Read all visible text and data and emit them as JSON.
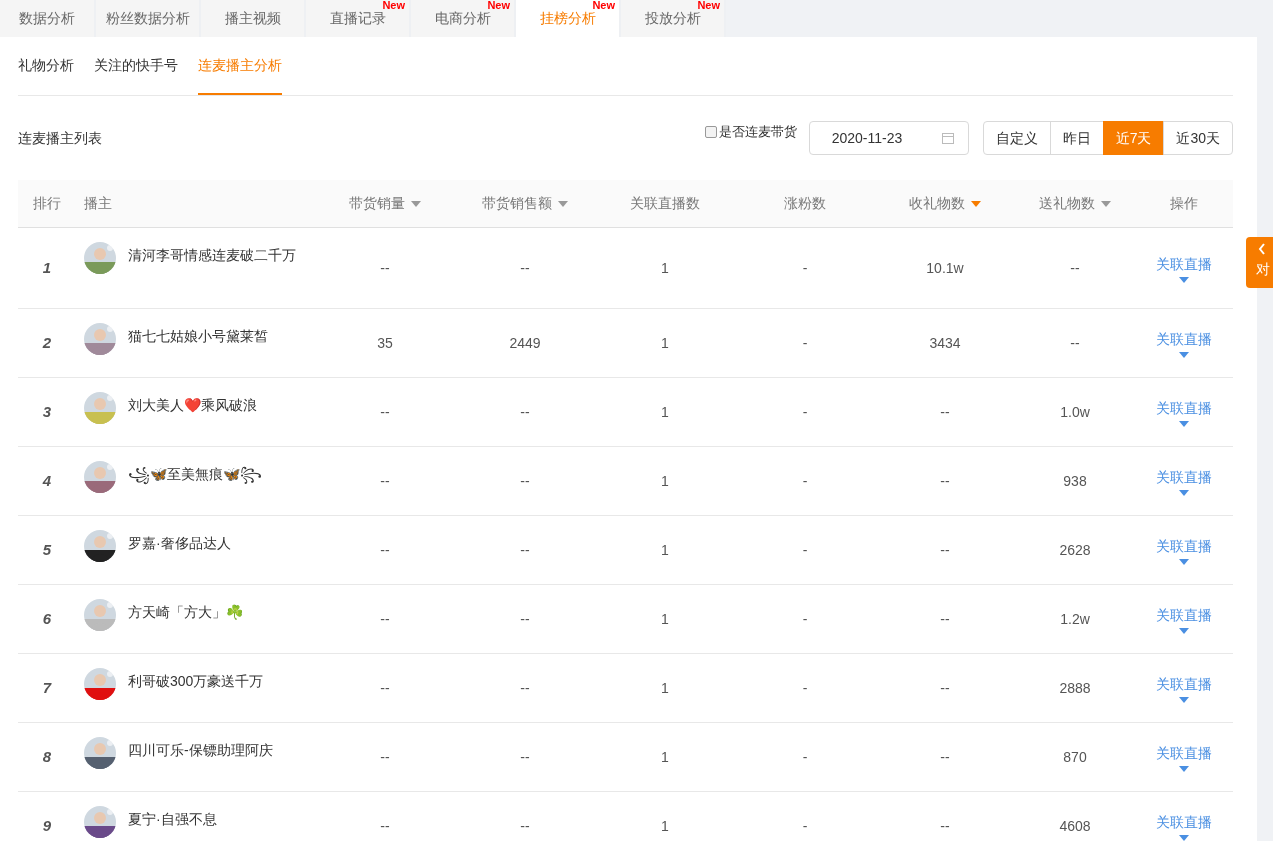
{
  "top_tabs": [
    {
      "label": "数据分析",
      "selected": false
    },
    {
      "label": "粉丝数据分析",
      "selected": false
    },
    {
      "label": "播主视频",
      "selected": false
    },
    {
      "label": "直播记录",
      "selected": false,
      "badge": "New"
    },
    {
      "label": "电商分析",
      "selected": false,
      "badge": "New"
    },
    {
      "label": "挂榜分析",
      "selected": true,
      "badge": "New"
    },
    {
      "label": "投放分析",
      "selected": false,
      "badge": "New"
    }
  ],
  "sub_tabs": [
    {
      "label": "礼物分析",
      "selected": false
    },
    {
      "label": "关注的快手号",
      "selected": false
    },
    {
      "label": "连麦播主分析",
      "selected": true
    }
  ],
  "list_title": "连麦播主列表",
  "filter_checkbox": {
    "label": "是否连麦带货",
    "checked": false
  },
  "date_field": {
    "value": "2020-11-23"
  },
  "range_buttons": [
    {
      "label": "自定义",
      "selected": false
    },
    {
      "label": "昨日",
      "selected": false
    },
    {
      "label": "近7天",
      "selected": true
    },
    {
      "label": "近30天",
      "selected": false
    }
  ],
  "table": {
    "columns": [
      {
        "label": "排行"
      },
      {
        "label": "播主"
      },
      {
        "label": "带货销量",
        "sorted": false
      },
      {
        "label": "带货销售额",
        "sorted": false
      },
      {
        "label": "关联直播数"
      },
      {
        "label": "涨粉数"
      },
      {
        "label": "收礼物数",
        "sorted": true
      },
      {
        "label": "送礼物数",
        "sorted": false
      },
      {
        "label": "操作"
      }
    ],
    "rows": [
      {
        "rank": "1",
        "name": "清河李哥情感连麦破二千万",
        "sales": "--",
        "revenue": "--",
        "lives": "1",
        "fans": "-",
        "gifts_received": "10.1w",
        "gifts_sent": "--",
        "action": "关联直播"
      },
      {
        "rank": "2",
        "name": "猫七七姑娘小号黛莱皙",
        "sales": "35",
        "revenue": "2449",
        "lives": "1",
        "fans": "-",
        "gifts_received": "3434",
        "gifts_sent": "--",
        "action": "关联直播"
      },
      {
        "rank": "3",
        "name": "刘大美人❤️乘风破浪",
        "sales": "--",
        "revenue": "--",
        "lives": "1",
        "fans": "-",
        "gifts_received": "--",
        "gifts_sent": "1.0w",
        "action": "关联直播"
      },
      {
        "rank": "4",
        "name": "꧁🦋至美無痕🦋꧂",
        "sales": "--",
        "revenue": "--",
        "lives": "1",
        "fans": "-",
        "gifts_received": "--",
        "gifts_sent": "938",
        "action": "关联直播"
      },
      {
        "rank": "5",
        "name": "罗嘉·奢侈品达人",
        "sales": "--",
        "revenue": "--",
        "lives": "1",
        "fans": "-",
        "gifts_received": "--",
        "gifts_sent": "2628",
        "action": "关联直播"
      },
      {
        "rank": "6",
        "name": "方天崎「方大」☘️",
        "sales": "--",
        "revenue": "--",
        "lives": "1",
        "fans": "-",
        "gifts_received": "--",
        "gifts_sent": "1.2w",
        "action": "关联直播"
      },
      {
        "rank": "7",
        "name": "利哥破300万豪送千万",
        "sales": "--",
        "revenue": "--",
        "lives": "1",
        "fans": "-",
        "gifts_received": "--",
        "gifts_sent": "2888",
        "action": "关联直播"
      },
      {
        "rank": "8",
        "name": "四川可乐-保镖助理阿庆",
        "sales": "--",
        "revenue": "--",
        "lives": "1",
        "fans": "-",
        "gifts_received": "--",
        "gifts_sent": "870",
        "action": "关联直播"
      },
      {
        "rank": "9",
        "name": "夏宁·自强不息",
        "sales": "--",
        "revenue": "--",
        "lives": "1",
        "fans": "-",
        "gifts_received": "--",
        "gifts_sent": "4608",
        "action": "关联直播"
      }
    ]
  },
  "side_tab": {
    "label": "对"
  }
}
